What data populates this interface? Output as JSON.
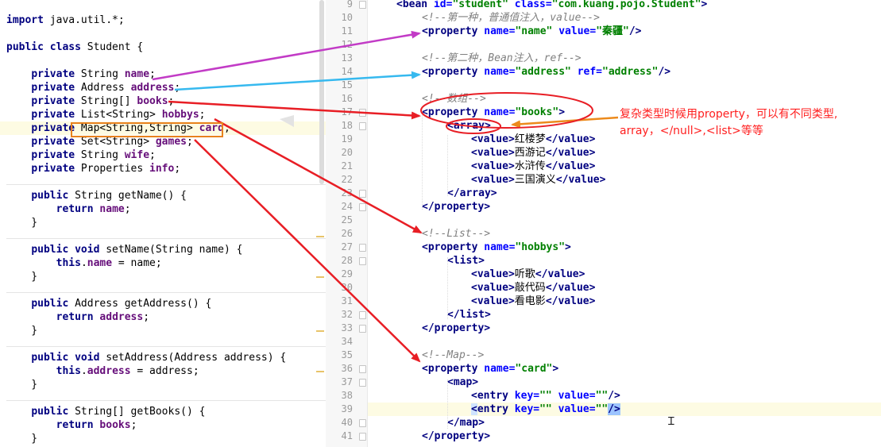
{
  "java": [
    {
      "t": "<span class=\"kw\">import</span> java.util.*;"
    },
    {
      "t": ""
    },
    {
      "t": "<span class=\"kw\">public class</span> Student {"
    },
    {
      "t": ""
    },
    {
      "t": "    <span class=\"kw\">private</span> String <span class=\"fld\">name</span>;"
    },
    {
      "t": "    <span class=\"kw\">private</span> Address <span class=\"fld\">address</span>;"
    },
    {
      "t": "    <span class=\"kw\">private</span> String[] <span class=\"fld\">books</span>;"
    },
    {
      "t": "    <span class=\"kw\">private</span> List&lt;String&gt; <span class=\"fld\">hobbys</span>;"
    },
    {
      "t": "    <span class=\"kw\">private</span> Map&lt;String,String&gt; <span class=\"fld\">card</span>;",
      "hl": true
    },
    {
      "t": "    <span class=\"kw\">private</span> Set&lt;String&gt; <span class=\"fld\">games</span>;"
    },
    {
      "t": "    <span class=\"kw\">private</span> String <span class=\"fld\">wife</span>;"
    },
    {
      "t": "    <span class=\"kw\">private</span> Properties <span class=\"fld\">info</span>;"
    },
    {
      "t": ""
    },
    {
      "t": "    <span class=\"kw\">public</span> String getName() {"
    },
    {
      "t": "        <span class=\"kw\">return</span> <span class=\"fld\">name</span>;"
    },
    {
      "t": "    }"
    },
    {
      "t": ""
    },
    {
      "t": "    <span class=\"kw\">public void</span> setName(String name) {"
    },
    {
      "t": "        <span class=\"kw\">this</span>.<span class=\"fld\">name</span> = name;"
    },
    {
      "t": "    }"
    },
    {
      "t": ""
    },
    {
      "t": "    <span class=\"kw\">public</span> Address getAddress() {"
    },
    {
      "t": "        <span class=\"kw\">return</span> <span class=\"fld\">address</span>;"
    },
    {
      "t": "    }"
    },
    {
      "t": ""
    },
    {
      "t": "    <span class=\"kw\">public void</span> setAddress(Address address) {"
    },
    {
      "t": "        <span class=\"kw\">this</span>.<span class=\"fld\">address</span> = address;"
    },
    {
      "t": "    }"
    },
    {
      "t": ""
    },
    {
      "t": "    <span class=\"kw\">public</span> String[] getBooks() {"
    },
    {
      "t": "        <span class=\"kw\">return</span> <span class=\"fld\">books</span>;"
    },
    {
      "t": "    }"
    }
  ],
  "xml_lines": [
    {
      "n": "9",
      "t": "<span class=\"tag\">&lt;bean</span> <span class=\"an\">id=</span><span class=\"av\">\"student\"</span> <span class=\"an\">class=</span><span class=\"av\">\"com.kuang.pojo.Student\"</span><span class=\"tag\">&gt;</span>",
      "indent": 36
    },
    {
      "n": "10",
      "t": "<span class=\"cm\">&lt;!--第一种，普通值注入，value--&gt;</span>",
      "indent": 68
    },
    {
      "n": "11",
      "t": "<span class=\"tag\">&lt;property</span> <span class=\"an\">name=</span><span class=\"av\">\"name\"</span> <span class=\"an\">value=</span><span class=\"av\">\"秦疆\"</span><span class=\"tag\">/&gt;</span>",
      "indent": 68
    },
    {
      "n": "12",
      "t": "",
      "indent": 68
    },
    {
      "n": "13",
      "t": "<span class=\"cm\">&lt;!--第二种，Bean注入，ref--&gt;</span>",
      "indent": 68
    },
    {
      "n": "14",
      "t": "<span class=\"tag\">&lt;property</span> <span class=\"an\">name=</span><span class=\"av\">\"address\"</span> <span class=\"an\">ref=</span><span class=\"av\">\"address\"</span><span class=\"tag\">/&gt;</span>",
      "indent": 68
    },
    {
      "n": "15",
      "t": "",
      "indent": 68
    },
    {
      "n": "16",
      "t": "<span class=\"cm\">&lt;!--数组--&gt;</span>",
      "indent": 68
    },
    {
      "n": "17",
      "t": "<span class=\"tag\">&lt;property</span> <span class=\"an\">name=</span><span class=\"av\">\"books\"</span><span class=\"tag\">&gt;</span>",
      "indent": 68
    },
    {
      "n": "18",
      "t": "<span class=\"tag\">&lt;array&gt;</span>",
      "indent": 100
    },
    {
      "n": "19",
      "t": "<span class=\"tag\">&lt;value&gt;</span>红楼梦<span class=\"tag\">&lt;/value&gt;</span>",
      "indent": 130
    },
    {
      "n": "20",
      "t": "<span class=\"tag\">&lt;value&gt;</span>西游记<span class=\"tag\">&lt;/value&gt;</span>",
      "indent": 130
    },
    {
      "n": "21",
      "t": "<span class=\"tag\">&lt;value&gt;</span>水浒传<span class=\"tag\">&lt;/value&gt;</span>",
      "indent": 130
    },
    {
      "n": "22",
      "t": "<span class=\"tag\">&lt;value&gt;</span>三国演义<span class=\"tag\">&lt;/value&gt;</span>",
      "indent": 130
    },
    {
      "n": "23",
      "t": "<span class=\"tag\">&lt;/array&gt;</span>",
      "indent": 100
    },
    {
      "n": "24",
      "t": "<span class=\"tag\">&lt;/property&gt;</span>",
      "indent": 68
    },
    {
      "n": "25",
      "t": "",
      "indent": 68
    },
    {
      "n": "26",
      "t": "<span class=\"cm\">&lt;!--List--&gt;</span>",
      "indent": 68
    },
    {
      "n": "27",
      "t": "<span class=\"tag\">&lt;property</span> <span class=\"an\">name=</span><span class=\"av\">\"hobbys\"</span><span class=\"tag\">&gt;</span>",
      "indent": 68
    },
    {
      "n": "28",
      "t": "<span class=\"tag\">&lt;list&gt;</span>",
      "indent": 100
    },
    {
      "n": "29",
      "t": "<span class=\"tag\">&lt;value&gt;</span>听歌<span class=\"tag\">&lt;/value&gt;</span>",
      "indent": 130
    },
    {
      "n": "30",
      "t": "<span class=\"tag\">&lt;value&gt;</span>敲代码<span class=\"tag\">&lt;/value&gt;</span>",
      "indent": 130
    },
    {
      "n": "31",
      "t": "<span class=\"tag\">&lt;value&gt;</span>看电影<span class=\"tag\">&lt;/value&gt;</span>",
      "indent": 130
    },
    {
      "n": "32",
      "t": "<span class=\"tag\">&lt;/list&gt;</span>",
      "indent": 100
    },
    {
      "n": "33",
      "t": "<span class=\"tag\">&lt;/property&gt;</span>",
      "indent": 68
    },
    {
      "n": "34",
      "t": "",
      "indent": 68
    },
    {
      "n": "35",
      "t": "<span class=\"cm\">&lt;!--Map--&gt;</span>",
      "indent": 68
    },
    {
      "n": "36",
      "t": "<span class=\"tag\">&lt;property</span> <span class=\"an\">name=</span><span class=\"av\">\"card\"</span><span class=\"tag\">&gt;</span>",
      "indent": 68
    },
    {
      "n": "37",
      "t": "<span class=\"tag\">&lt;map&gt;</span>",
      "indent": 100
    },
    {
      "n": "38",
      "t": "<span class=\"tag\">&lt;entry</span> <span class=\"an\">key=</span><span class=\"av\">\"\"</span> <span class=\"an\">value=</span><span class=\"av\">\"\"</span><span class=\"tag\">/&gt;</span>",
      "indent": 130
    },
    {
      "n": "39",
      "t": "<span class=\"tag\" style=\"background:#cfe3ff\">&lt;</span><span class=\"tag\">entry</span> <span class=\"an\">key=</span><span class=\"av\">\"\"</span> <span class=\"an\">value=</span><span class=\"av\">\"\"</span><span class=\"tag\" style=\"background:#9cc4ff\">/&gt;</span>",
      "indent": 130,
      "hl": true
    },
    {
      "n": "40",
      "t": "<span class=\"tag\">&lt;/map&gt;</span>",
      "indent": 100
    },
    {
      "n": "41",
      "t": "<span class=\"tag\">&lt;/property&gt;</span>",
      "indent": 68
    }
  ],
  "annotation": {
    "line1": "复杂类型时候用property，可以有不同类型,",
    "line2": "array，</null>,<list>等等"
  }
}
